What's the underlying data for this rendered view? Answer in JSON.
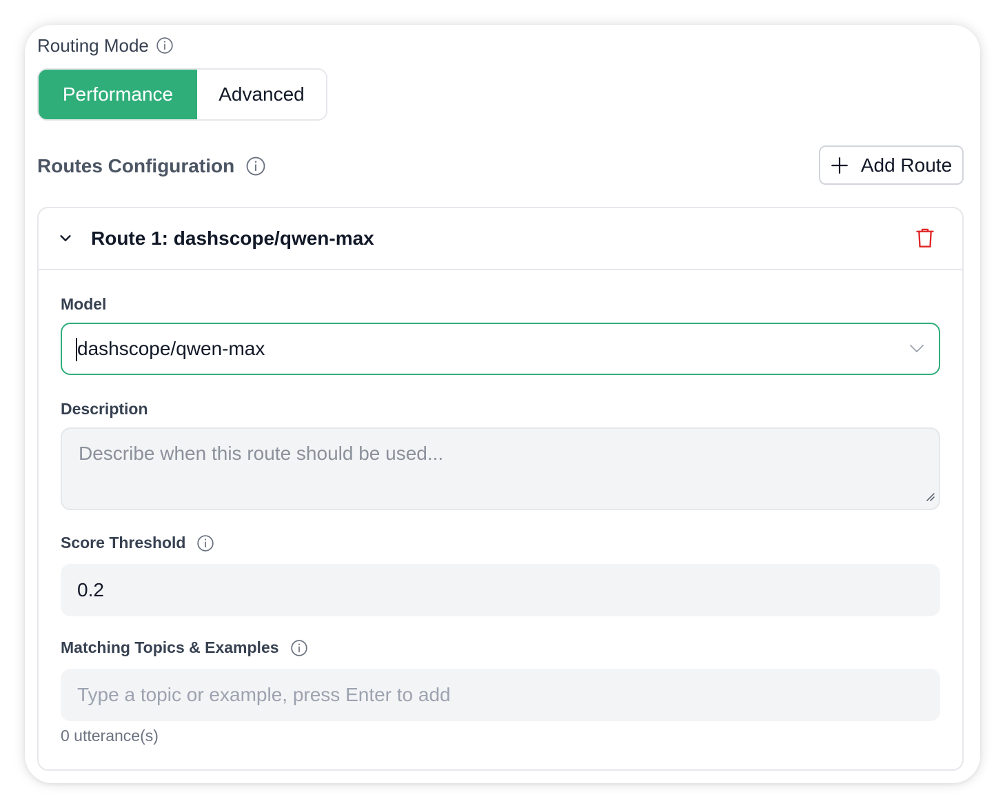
{
  "routing_mode": {
    "label": "Routing Mode",
    "options": [
      "Performance",
      "Advanced"
    ],
    "selected": "Performance"
  },
  "routes_config": {
    "title": "Routes Configuration",
    "add_button_label": "Add Route"
  },
  "route": {
    "title": "Route 1: dashscope/qwen-max",
    "model_label": "Model",
    "model_value": "dashscope/qwen-max",
    "description_label": "Description",
    "description_placeholder": "Describe when this route should be used...",
    "score_threshold_label": "Score Threshold",
    "score_threshold_value": "0.2",
    "topics_label": "Matching Topics & Examples",
    "topics_placeholder": "Type a topic or example, press Enter to add",
    "utterance_count": "0 utterance(s)"
  },
  "colors": {
    "accent": "#2fae7a",
    "danger": "#e02424",
    "muted_text": "#6b7280",
    "input_bg": "#f3f4f6"
  },
  "icons": {
    "info": "info-circle-icon",
    "plus": "plus-icon",
    "collapse": "chevron-down-icon",
    "delete": "trash-icon",
    "select": "chevron-down-icon"
  }
}
